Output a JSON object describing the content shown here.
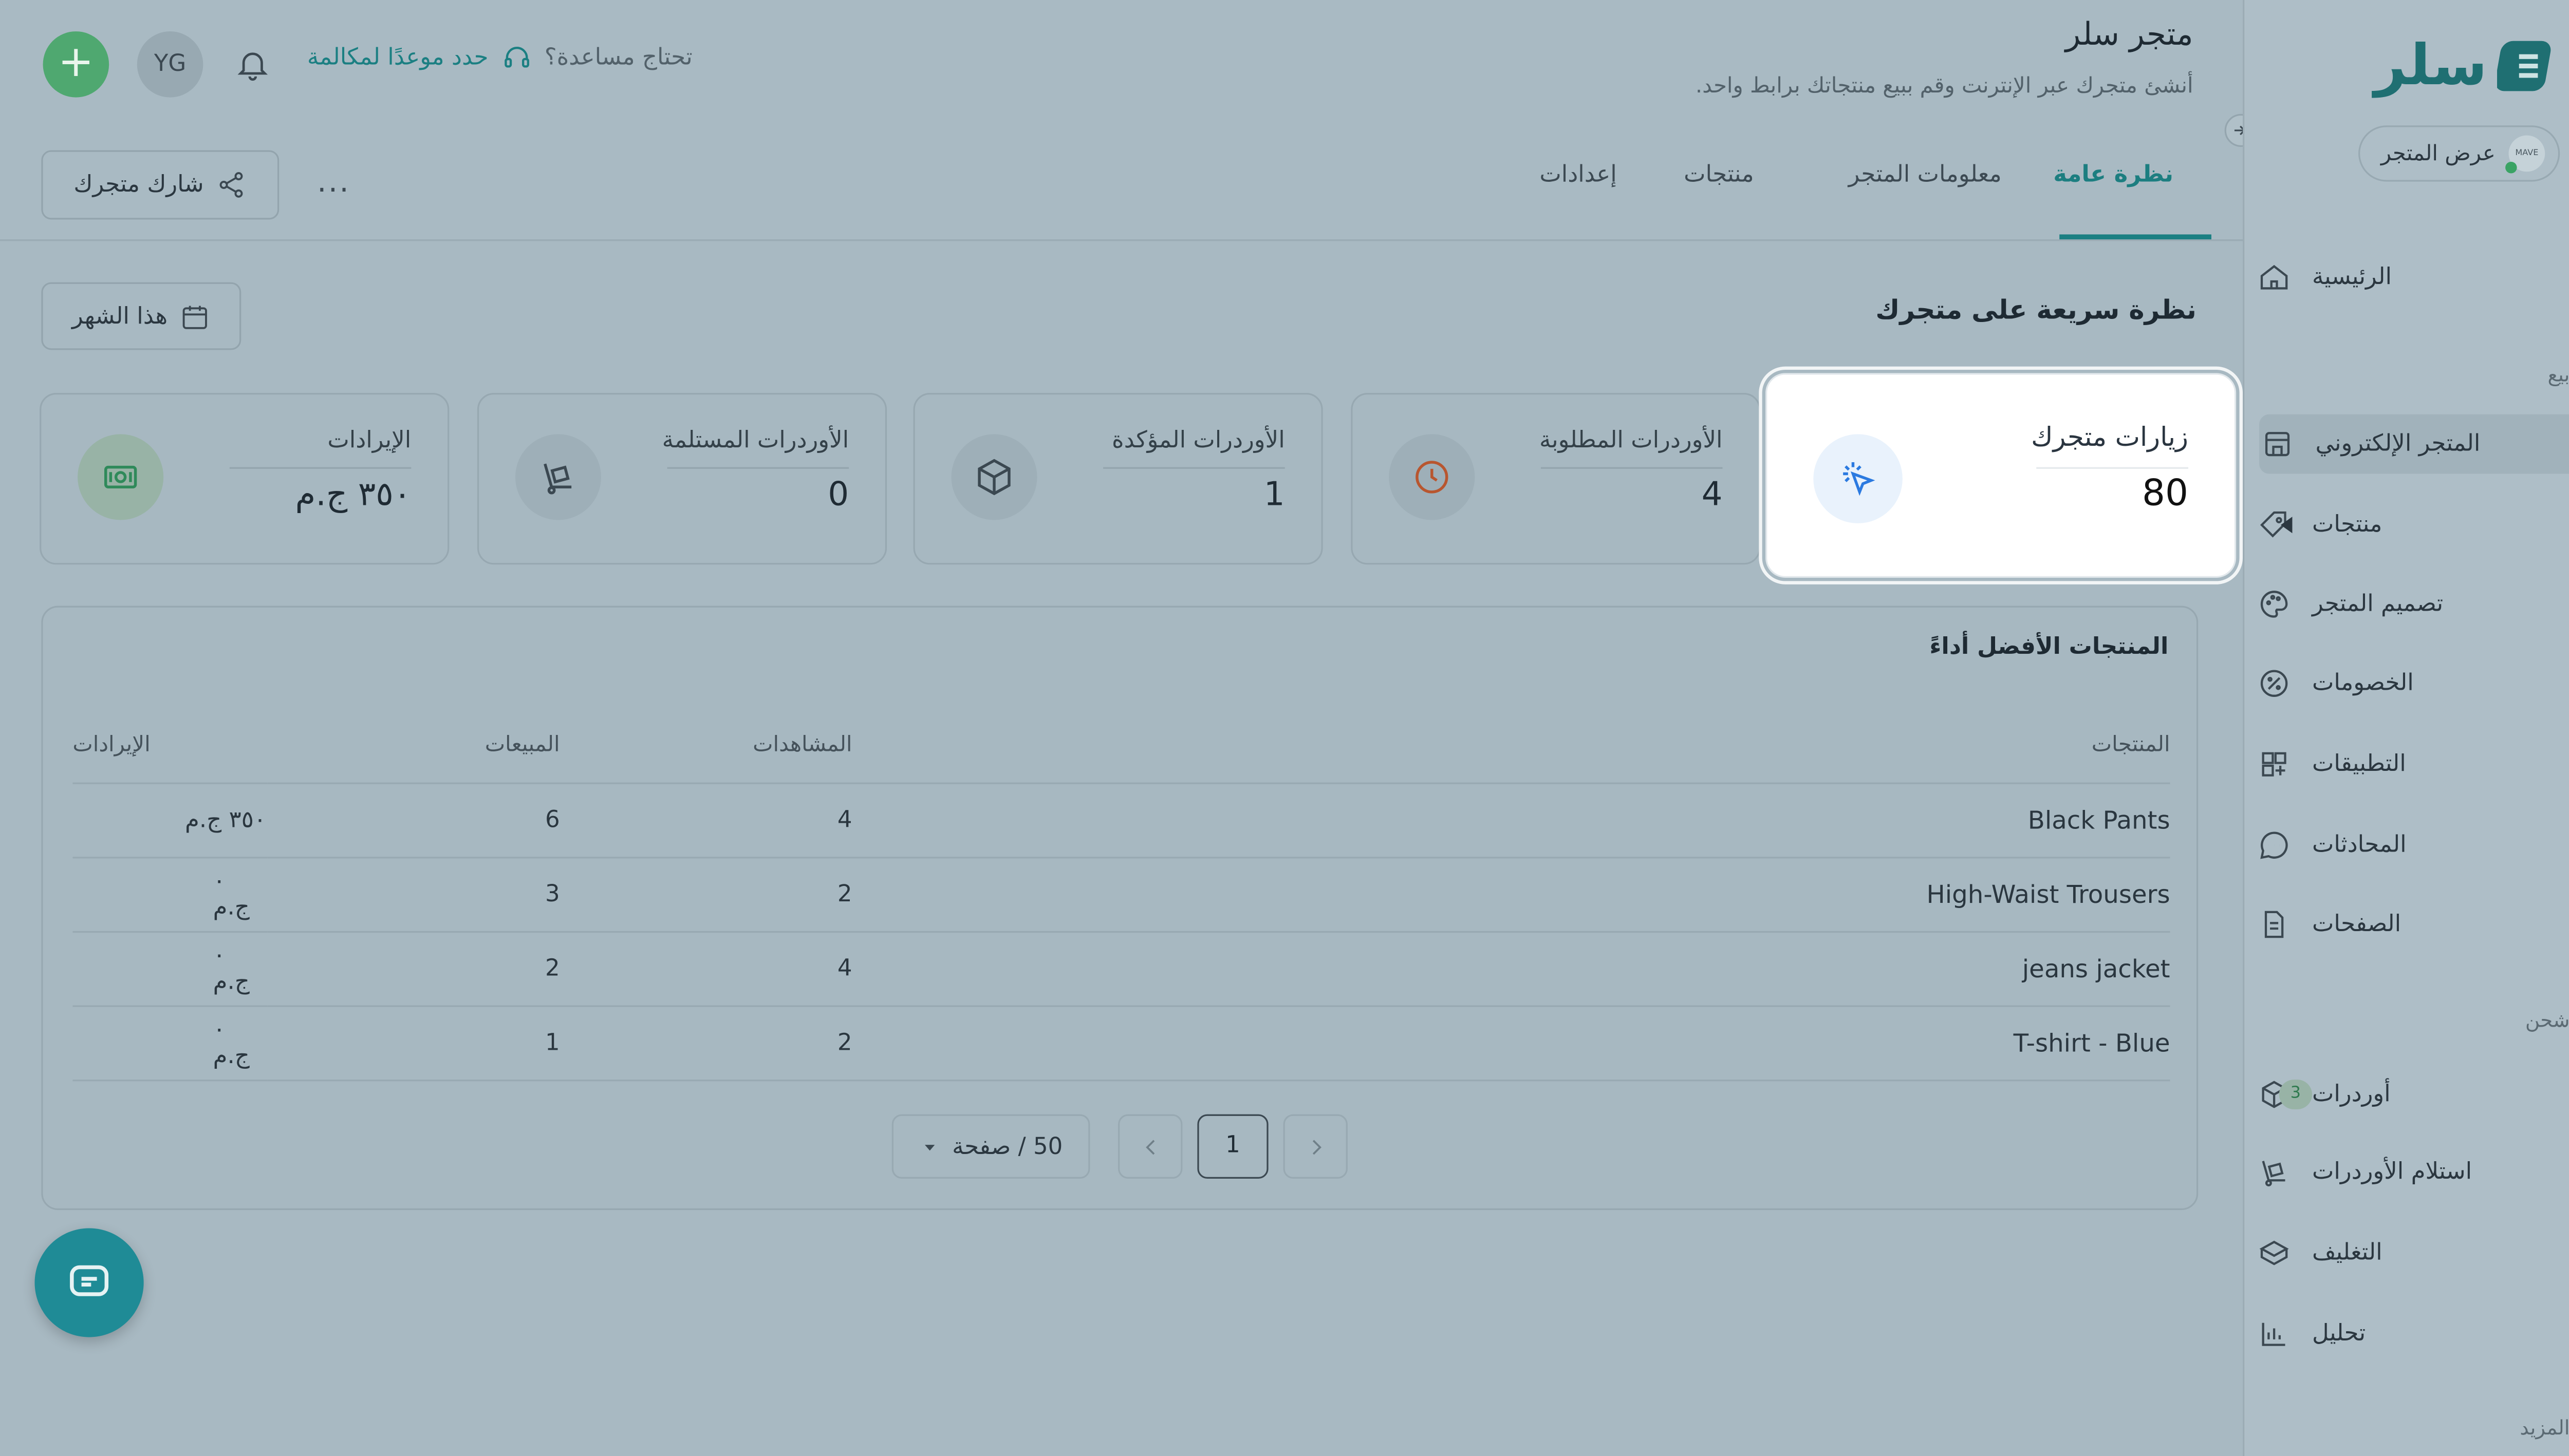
{
  "brand": {
    "logo_text": "سلر"
  },
  "store_view": {
    "label": "عرض المتجر",
    "avatar_text": "MAVE"
  },
  "sidebar": {
    "items_top": [
      {
        "label": "الرئيسية",
        "icon": "home-icon"
      }
    ],
    "section_sell": "بيع",
    "items_sell": [
      {
        "label": "المتجر الإلكتروني",
        "icon": "store-icon",
        "active": true
      },
      {
        "label": "منتجات",
        "icon": "tag-icon"
      },
      {
        "label": "تصميم المتجر",
        "icon": "palette-icon"
      },
      {
        "label": "الخصومات",
        "icon": "discount-icon"
      },
      {
        "label": "التطبيقات",
        "icon": "apps-icon"
      },
      {
        "label": "المحادثات",
        "icon": "chat-icon"
      },
      {
        "label": "الصفحات",
        "icon": "page-icon"
      }
    ],
    "section_ship": "شحن",
    "items_ship": [
      {
        "label": "أوردرات",
        "icon": "box-icon",
        "badge": "3"
      },
      {
        "label": "استلام الأوردرات",
        "icon": "dolly-icon"
      },
      {
        "label": "التغليف",
        "icon": "package-icon"
      },
      {
        "label": "تحليل",
        "icon": "chart-icon"
      }
    ],
    "section_more": "المزيد"
  },
  "header": {
    "title": "متجر سلر",
    "subtitle": "أنشئ متجرك عبر الإنترنت وقم ببيع منتجاتك برابط واحد.",
    "help_text": "تحتاج مساعدة؟",
    "help_link": "حدد موعدًا لمكالمة",
    "user_initials": "YG",
    "add_symbol": "+"
  },
  "tabs": [
    {
      "label": "نظرة عامة",
      "active": true
    },
    {
      "label": "معلومات المتجر"
    },
    {
      "label": "منتجات"
    },
    {
      "label": "إعدادات"
    }
  ],
  "share_button": "شارك متجرك",
  "more_symbol": "...",
  "overview": {
    "title": "نظرة سريعة على متجرك",
    "period": "هذا الشهر"
  },
  "stats": [
    {
      "title": "زيارات متجرك",
      "value": "80",
      "icon": "cursor-click-icon",
      "color": "#2b7ae0",
      "highlighted": true
    },
    {
      "title": "الأوردرات المطلوبة",
      "value": "4",
      "icon": "clock-icon",
      "color": "#b8562f"
    },
    {
      "title": "الأوردرات المؤكدة",
      "value": "1",
      "icon": "box-icon",
      "color": "#3b4851"
    },
    {
      "title": "الأوردرات المستلمة",
      "value": "0",
      "icon": "dolly-icon",
      "color": "#3b4851"
    },
    {
      "title": "الإيرادات",
      "value": "٣٥٠ ج.م",
      "icon": "cash-icon",
      "color": "#2f8a5a"
    }
  ],
  "top_products": {
    "title": "المنتجات الأفضل أداءً",
    "columns": {
      "product": "المنتجات",
      "views": "المشاهدات",
      "sales": "المبيعات",
      "revenue": "الإيرادات"
    },
    "rows": [
      {
        "product": "Black Pants",
        "views": "4",
        "sales": "6",
        "revenue": "٣٥٠ ج.م"
      },
      {
        "product": "High-Waist Trousers",
        "views": "2",
        "sales": "3",
        "revenue": "٠ ج.م"
      },
      {
        "product": "jeans jacket",
        "views": "4",
        "sales": "2",
        "revenue": "٠ ج.م"
      },
      {
        "product": "T-shirt - Blue",
        "views": "2",
        "sales": "1",
        "revenue": "٠ ج.م"
      }
    ],
    "pagination": {
      "current_page": "1",
      "per_page": "50 / صفحة"
    }
  },
  "colors": {
    "accent": "#1b8f8f",
    "overlay": "#a8b9c2",
    "chat_fab": "#1f8b96",
    "add_button": "#4cae6a"
  }
}
